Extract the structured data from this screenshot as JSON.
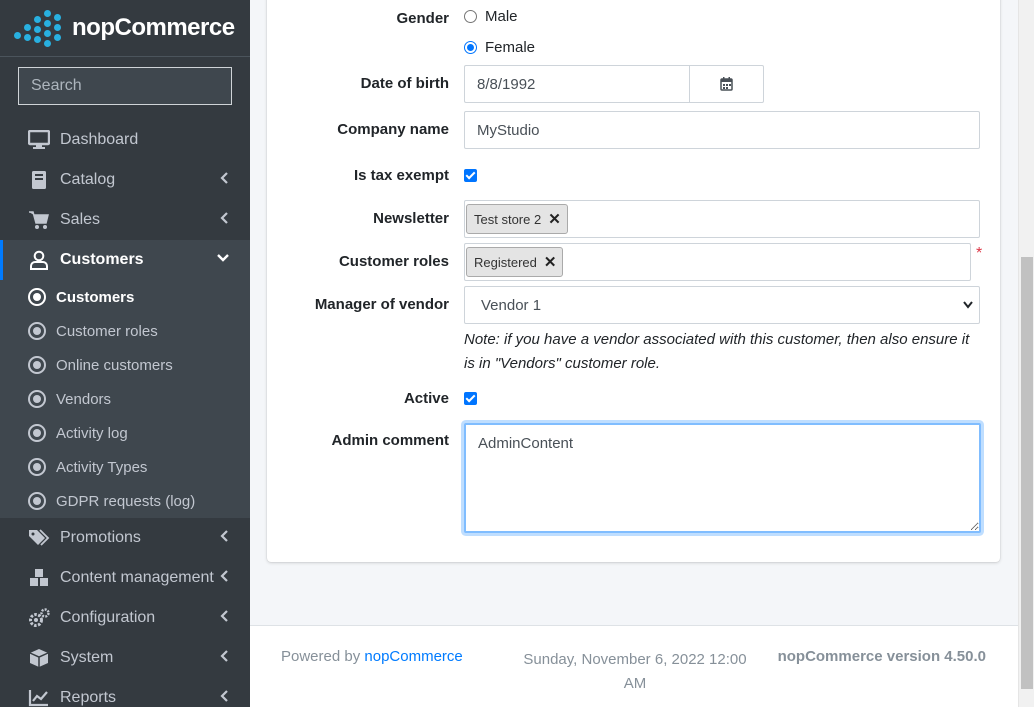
{
  "brand": {
    "name": "nopCommerce"
  },
  "search": {
    "placeholder": "Search"
  },
  "sidebar": {
    "items": [
      {
        "label": "Dashboard",
        "icon": "monitor-icon"
      },
      {
        "label": "Catalog",
        "icon": "book-icon"
      },
      {
        "label": "Sales",
        "icon": "cart-icon"
      },
      {
        "label": "Customers",
        "icon": "user-icon"
      },
      {
        "label": "Promotions",
        "icon": "tags-icon"
      },
      {
        "label": "Content management",
        "icon": "cubes-icon"
      },
      {
        "label": "Configuration",
        "icon": "cogs-icon"
      },
      {
        "label": "System",
        "icon": "cube-icon"
      },
      {
        "label": "Reports",
        "icon": "chart-icon"
      }
    ],
    "customers_sub": [
      {
        "label": "Customers"
      },
      {
        "label": "Customer roles"
      },
      {
        "label": "Online customers"
      },
      {
        "label": "Vendors"
      },
      {
        "label": "Activity log"
      },
      {
        "label": "Activity Types"
      },
      {
        "label": "GDPR requests (log)"
      }
    ]
  },
  "form": {
    "gender": {
      "label": "Gender",
      "options": [
        "Male",
        "Female"
      ],
      "selected": "Female"
    },
    "dob": {
      "label": "Date of birth",
      "value": "8/8/1992"
    },
    "company": {
      "label": "Company name",
      "value": "MyStudio"
    },
    "tax_exempt": {
      "label": "Is tax exempt",
      "checked": true
    },
    "newsletter": {
      "label": "Newsletter",
      "tags": [
        "Test store 2"
      ]
    },
    "roles": {
      "label": "Customer roles",
      "tags": [
        "Registered"
      ],
      "required_mark": "*"
    },
    "vendor": {
      "label": "Manager of vendor",
      "value": "Vendor 1",
      "note": "Note: if you have a vendor associated with this customer, then also ensure it is in \"Vendors\" customer role."
    },
    "active": {
      "label": "Active",
      "checked": true
    },
    "admin_comment": {
      "label": "Admin comment",
      "value": "AdminContent"
    }
  },
  "footer": {
    "powered_prefix": "Powered by ",
    "powered_link": "nopCommerce",
    "datetime": "Sunday, November 6, 2022 12:00 AM",
    "version": "nopCommerce version 4.50.0"
  },
  "colors": {
    "sidebar_bg": "#343a40",
    "accent": "#007bff",
    "logo": "#28b0e0"
  }
}
